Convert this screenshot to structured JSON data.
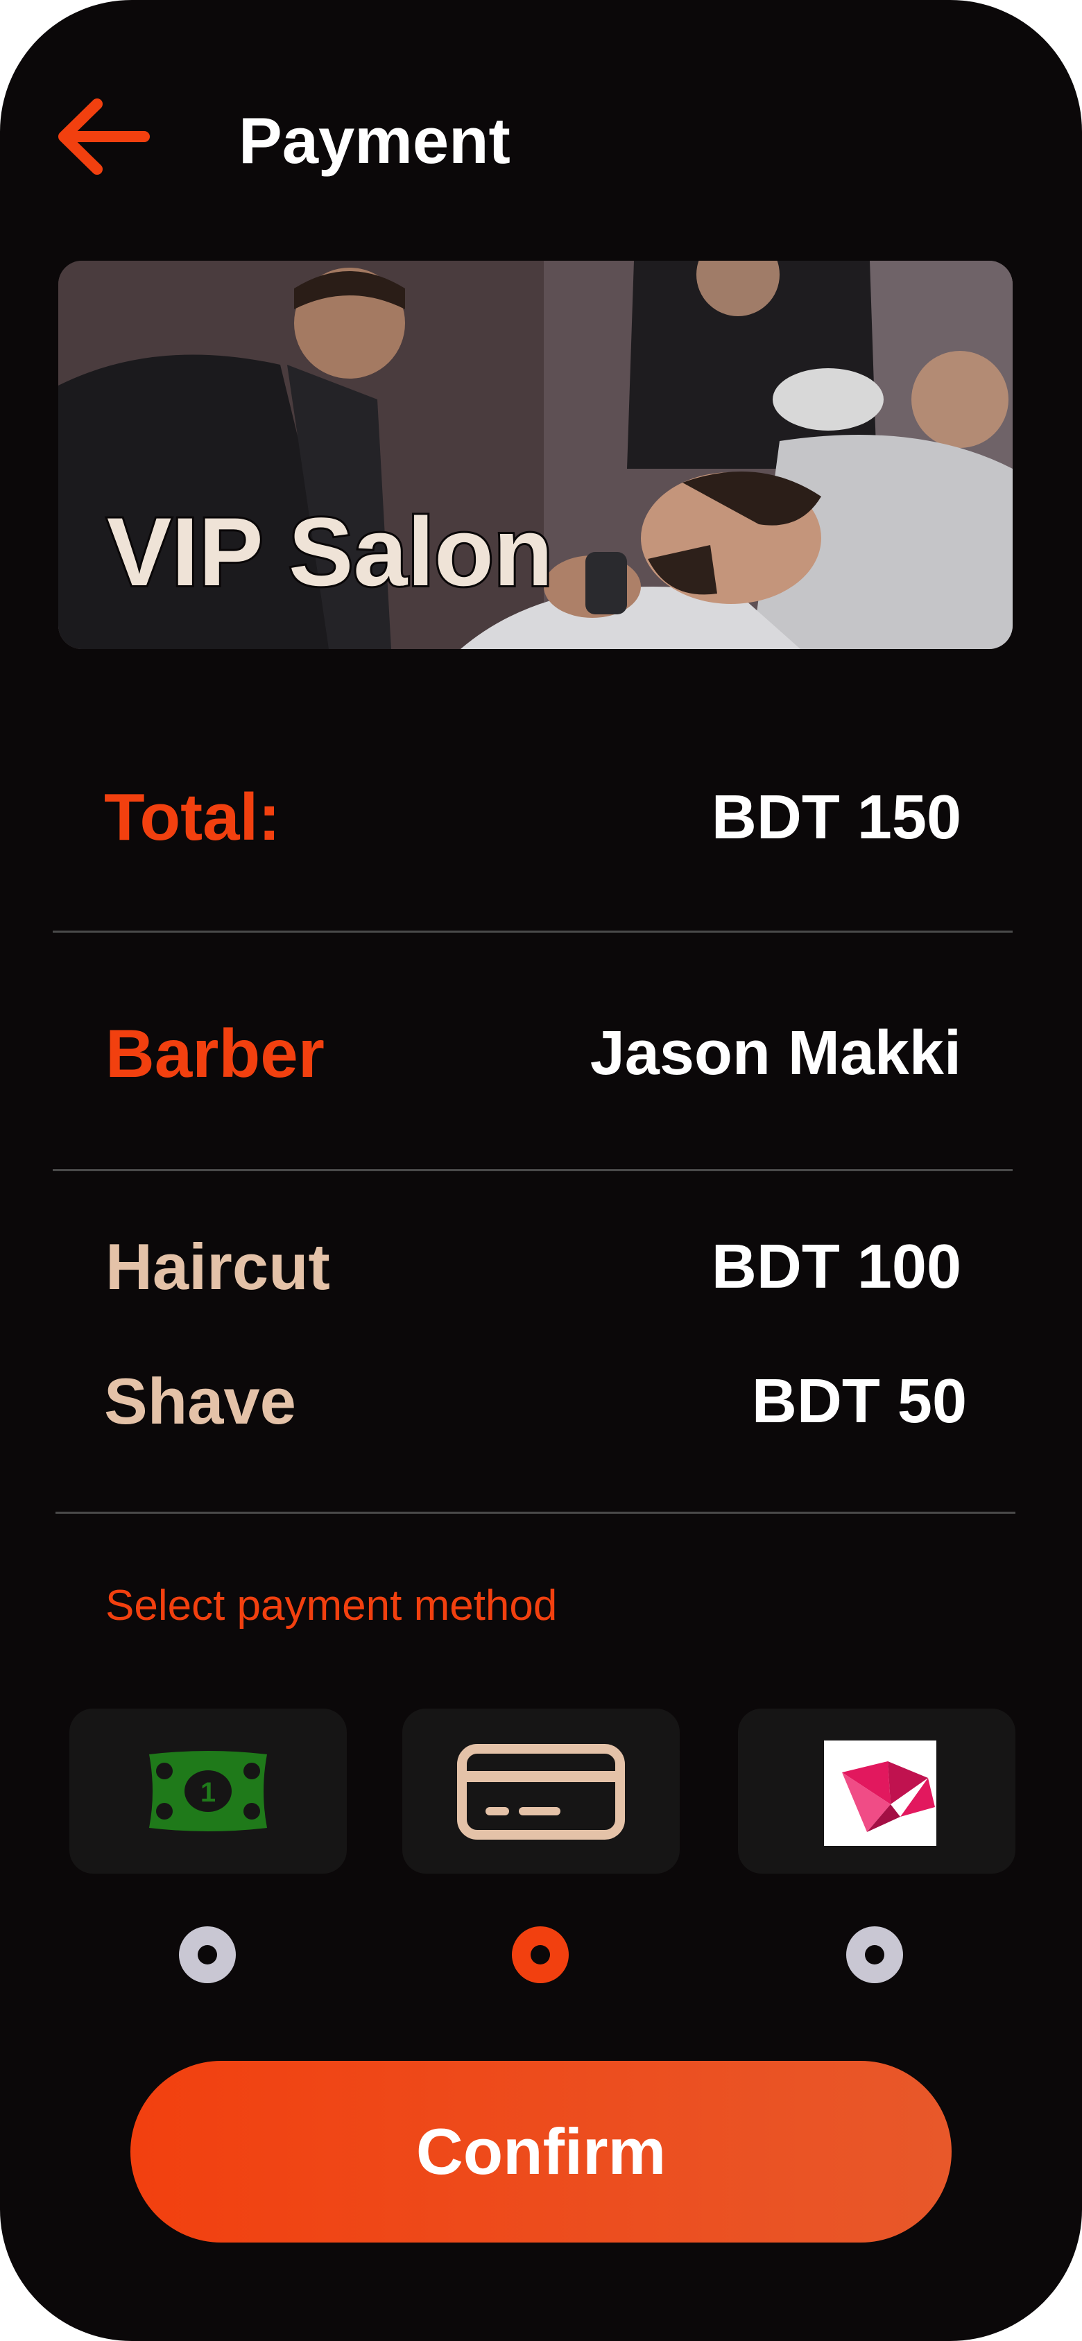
{
  "header": {
    "title": "Payment",
    "back_icon": "arrow-left-icon"
  },
  "hero": {
    "title": "VIP Salon"
  },
  "summary": {
    "total_label": "Total:",
    "total_value": "BDT 150",
    "barber_label": "Barber",
    "barber_value": "Jason Makki"
  },
  "services": [
    {
      "name": "Haircut",
      "price": "BDT 100"
    },
    {
      "name": "Shave",
      "price": "BDT 50"
    }
  ],
  "payment": {
    "label": "Select payment method",
    "methods": [
      {
        "icon": "cash-icon",
        "selected": false
      },
      {
        "icon": "credit-card-icon",
        "selected": true
      },
      {
        "icon": "origami-bird-logo-icon",
        "selected": false
      }
    ]
  },
  "confirm_label": "Confirm",
  "colors": {
    "accent": "#f2400f",
    "background": "#0b0809",
    "beige": "#e4c2a8",
    "radio_inactive": "#c9c7d3",
    "cash_green": "#1f7a1a"
  }
}
